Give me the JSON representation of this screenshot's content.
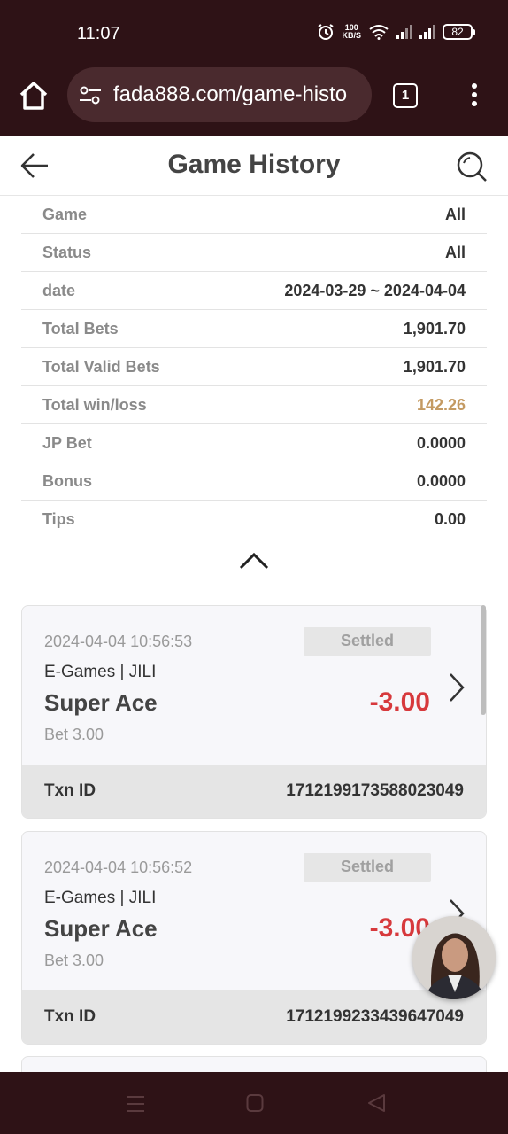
{
  "status_bar": {
    "time": "11:07",
    "net_speed_value": "100",
    "net_speed_unit": "KB/S",
    "battery": "82"
  },
  "browser": {
    "url": "fada888.com/game-histo",
    "tab_count": "1"
  },
  "header": {
    "title": "Game History"
  },
  "summary": [
    {
      "label": "Game",
      "value": "All"
    },
    {
      "label": "Status",
      "value": "All"
    },
    {
      "label": "date",
      "value": "2024-03-29 ~ 2024-04-04"
    },
    {
      "label": "Total Bets",
      "value": "1,901.70"
    },
    {
      "label": "Total Valid Bets",
      "value": "1,901.70"
    },
    {
      "label": "Total win/loss",
      "value": "142.26"
    },
    {
      "label": "JP Bet",
      "value": "0.0000"
    },
    {
      "label": "Bonus",
      "value": "0.0000"
    },
    {
      "label": "Tips",
      "value": "0.00"
    }
  ],
  "records": [
    {
      "datetime": "2024-04-04 10:56:53",
      "status": "Settled",
      "provider": "E-Games | JILI",
      "game": "Super Ace",
      "amount": "-3.00",
      "bet": "Bet 3.00",
      "txn_label": "Txn ID",
      "txn_id": "1712199173588023049"
    },
    {
      "datetime": "2024-04-04 10:56:52",
      "status": "Settled",
      "provider": "E-Games | JILI",
      "game": "Super Ace",
      "amount": "-3.00",
      "bet": "Bet 3.00",
      "txn_label": "Txn ID",
      "txn_id": "1712199233439647049"
    }
  ],
  "colors": {
    "chrome_bg": "#2e1216",
    "win_loss": "#c49a62",
    "loss_amount": "#d7393c"
  },
  "icons": [
    "home-icon",
    "site-settings-icon",
    "tabs-icon",
    "more-icon",
    "back-arrow-icon",
    "search-icon",
    "collapse-chevron-icon",
    "chevron-right-icon",
    "nav-menu-icon",
    "nav-home-icon",
    "nav-back-icon",
    "alarm-icon",
    "wifi-icon",
    "signal-icon",
    "battery-icon"
  ]
}
